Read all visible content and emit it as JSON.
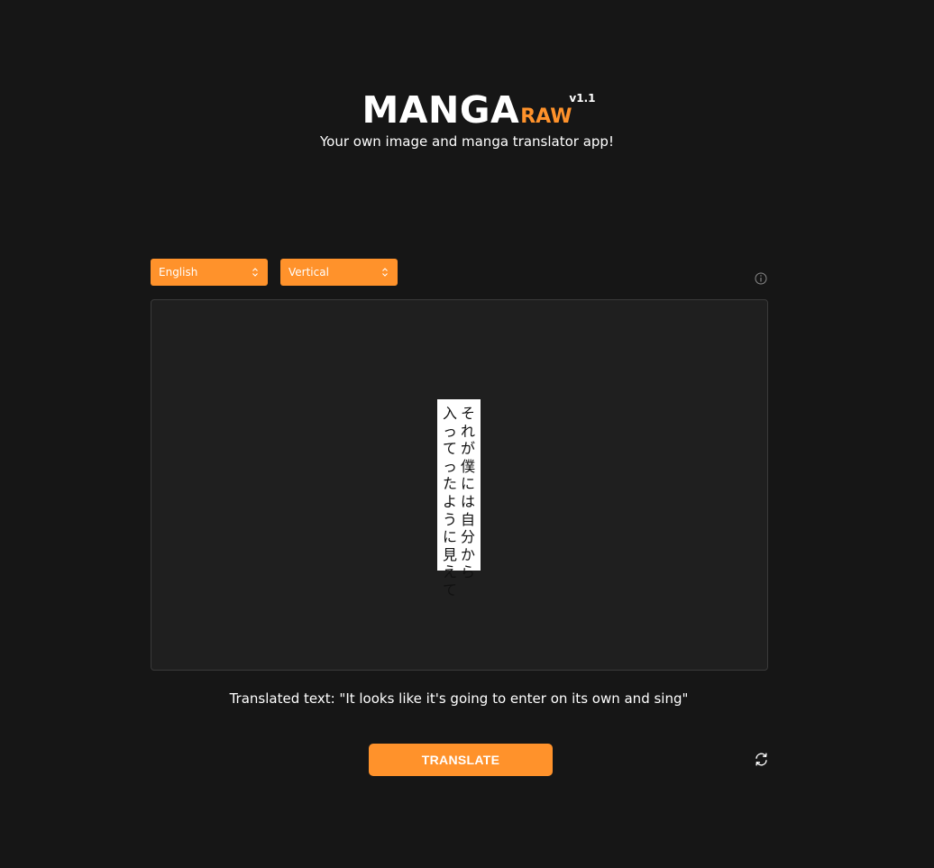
{
  "brand": {
    "name": "MANGA",
    "sub": "RAW",
    "version": "v1.1",
    "tagline": "Your own image and manga translator app!"
  },
  "controls": {
    "language": {
      "selected": "English"
    },
    "orientation": {
      "selected": "Vertical"
    },
    "info_icon": "info-circle-icon"
  },
  "image": {
    "columns": [
      [
        "そ",
        "れ",
        "が",
        "僕",
        "に",
        "は",
        "自",
        "分",
        "か",
        "ら"
      ],
      [
        "入",
        "っ",
        "て",
        "っ",
        "た",
        "よ",
        "う",
        "に",
        "見",
        "え",
        "て"
      ]
    ]
  },
  "result": {
    "label": "Translated text: \"It looks like it's going to enter on its own and sing\""
  },
  "actions": {
    "translate_label": "TRANSLATE",
    "refresh_icon": "refresh-icon"
  },
  "colors": {
    "background": "#161616",
    "accent": "#ff922b",
    "panel": "#1f1f1f"
  }
}
